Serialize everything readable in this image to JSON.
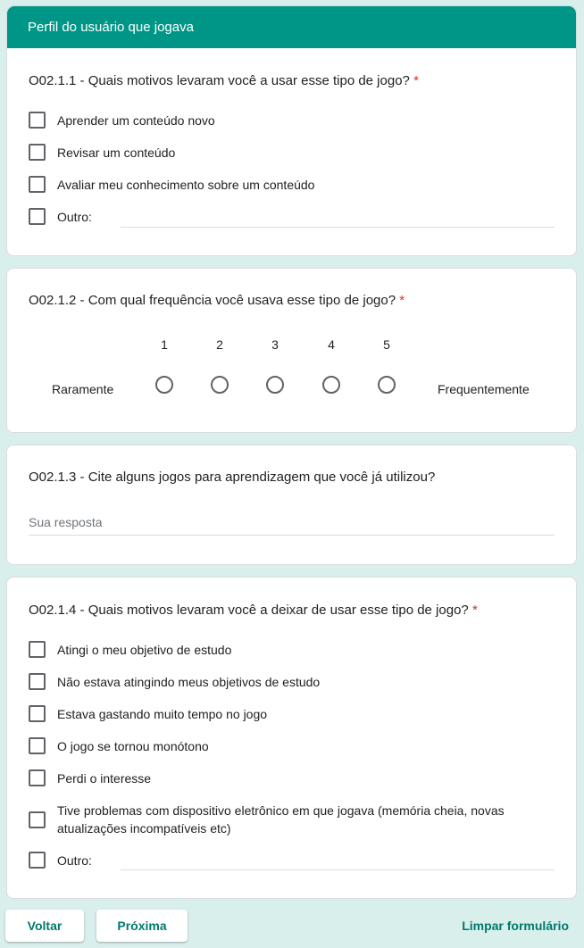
{
  "section_title": "Perfil do usuário que jogava",
  "q1": {
    "title": "O02.1.1 - Quais motivos levaram você a usar esse tipo de jogo?",
    "required": "*",
    "options": [
      "Aprender um conteúdo novo",
      "Revisar um conteúdo",
      "Avaliar meu conhecimento sobre um conteúdo",
      "Outro:"
    ]
  },
  "q2": {
    "title": "O02.1.2 - Com qual frequência você usava esse tipo de jogo?",
    "required": "*",
    "scale": [
      "1",
      "2",
      "3",
      "4",
      "5"
    ],
    "min_label": "Raramente",
    "max_label": "Frequentemente"
  },
  "q3": {
    "title": "O02.1.3 - Cite alguns jogos para aprendizagem que você já utilizou?",
    "placeholder": "Sua resposta"
  },
  "q4": {
    "title": "O02.1.4 - Quais motivos levaram você a deixar de usar esse tipo de jogo?",
    "required": "*",
    "options": [
      "Atingi o meu objetivo de estudo",
      "Não estava atingindo meus objetivos de estudo",
      "Estava gastando muito tempo no jogo",
      "O jogo se tornou monótono",
      "Perdi o interesse",
      "Tive problemas com dispositivo eletrônico em que jogava (memória cheia, novas atualizações incompatíveis etc)",
      "Outro:"
    ]
  },
  "buttons": {
    "back": "Voltar",
    "next": "Próxima",
    "clear": "Limpar formulário"
  }
}
